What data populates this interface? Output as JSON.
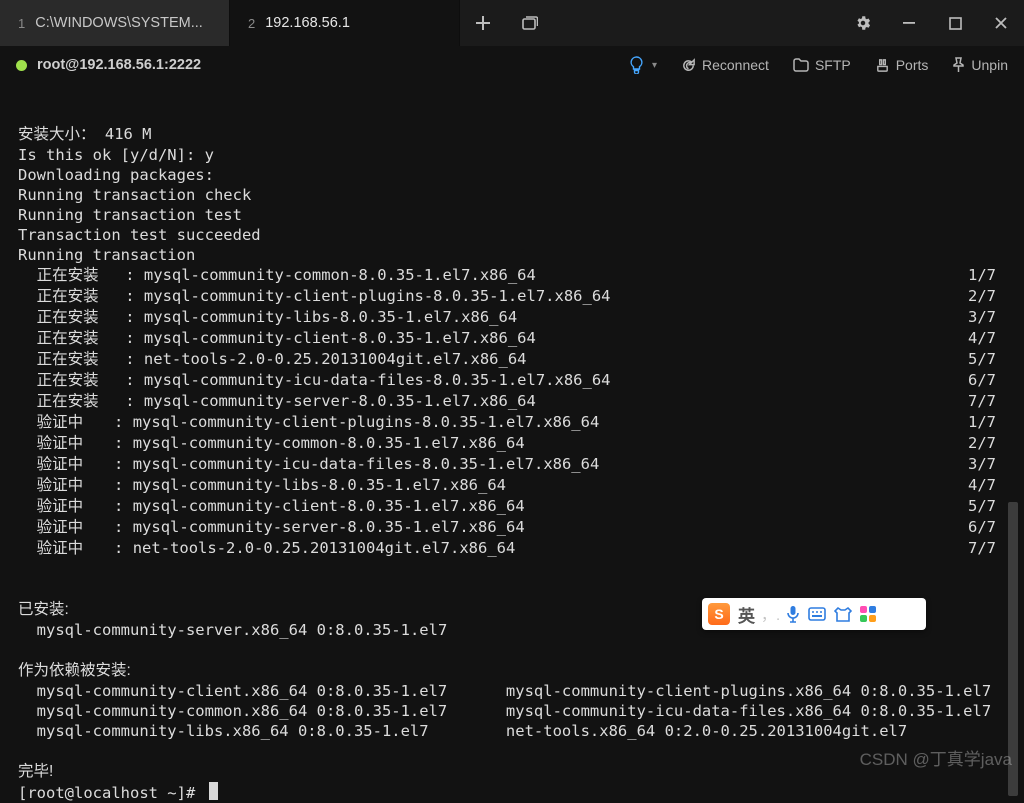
{
  "titlebar": {
    "tabs": [
      {
        "num": "1",
        "label": "C:\\WINDOWS\\SYSTEM..."
      },
      {
        "num": "2",
        "label": "192.168.56.1"
      }
    ]
  },
  "connbar": {
    "title": "root@192.168.56.1:2222",
    "reconnect": "Reconnect",
    "sftp": "SFTP",
    "ports": "Ports",
    "unpin": "Unpin"
  },
  "term": {
    "install_size_label": "安装大小：",
    "install_size_value": "416 M",
    "confirm_prompt": "Is this ok [y/d/N]: ",
    "confirm_answer": "y",
    "downloading": "Downloading packages:",
    "check": "Running transaction check",
    "test": "Running transaction test",
    "test_ok": "Transaction test succeeded",
    "running": "Running transaction",
    "installing_label": "正在安装",
    "verifying_label": "验证中",
    "steps": [
      {
        "phase": "install",
        "pkg": "mysql-community-common-8.0.35-1.el7.x86_64",
        "n": "1/7"
      },
      {
        "phase": "install",
        "pkg": "mysql-community-client-plugins-8.0.35-1.el7.x86_64",
        "n": "2/7"
      },
      {
        "phase": "install",
        "pkg": "mysql-community-libs-8.0.35-1.el7.x86_64",
        "n": "3/7"
      },
      {
        "phase": "install",
        "pkg": "mysql-community-client-8.0.35-1.el7.x86_64",
        "n": "4/7"
      },
      {
        "phase": "install",
        "pkg": "net-tools-2.0-0.25.20131004git.el7.x86_64",
        "n": "5/7"
      },
      {
        "phase": "install",
        "pkg": "mysql-community-icu-data-files-8.0.35-1.el7.x86_64",
        "n": "6/7"
      },
      {
        "phase": "install",
        "pkg": "mysql-community-server-8.0.35-1.el7.x86_64",
        "n": "7/7"
      },
      {
        "phase": "verify",
        "pkg": "mysql-community-client-plugins-8.0.35-1.el7.x86_64",
        "n": "1/7"
      },
      {
        "phase": "verify",
        "pkg": "mysql-community-common-8.0.35-1.el7.x86_64",
        "n": "2/7"
      },
      {
        "phase": "verify",
        "pkg": "mysql-community-icu-data-files-8.0.35-1.el7.x86_64",
        "n": "3/7"
      },
      {
        "phase": "verify",
        "pkg": "mysql-community-libs-8.0.35-1.el7.x86_64",
        "n": "4/7"
      },
      {
        "phase": "verify",
        "pkg": "mysql-community-client-8.0.35-1.el7.x86_64",
        "n": "5/7"
      },
      {
        "phase": "verify",
        "pkg": "mysql-community-server-8.0.35-1.el7.x86_64",
        "n": "6/7"
      },
      {
        "phase": "verify",
        "pkg": "net-tools-2.0-0.25.20131004git.el7.x86_64",
        "n": "7/7"
      }
    ],
    "installed_header": "已安装:",
    "installed_pkg": "mysql-community-server.x86_64 0:8.0.35-1.el7",
    "deps_header": "作为依赖被安装:",
    "deps_col1": [
      "mysql-community-client.x86_64 0:8.0.35-1.el7",
      "mysql-community-common.x86_64 0:8.0.35-1.el7",
      "mysql-community-libs.x86_64 0:8.0.35-1.el7"
    ],
    "deps_col2": [
      "mysql-community-client-plugins.x86_64 0:8.0.35-1.el7",
      "mysql-community-icu-data-files.x86_64 0:8.0.35-1.el7",
      "net-tools.x86_64 0:2.0-0.25.20131004git.el7"
    ],
    "done": "完毕!",
    "prompt": "[root@localhost ~]# "
  },
  "ime": {
    "han": "英"
  },
  "watermark": "CSDN @丁真学java"
}
